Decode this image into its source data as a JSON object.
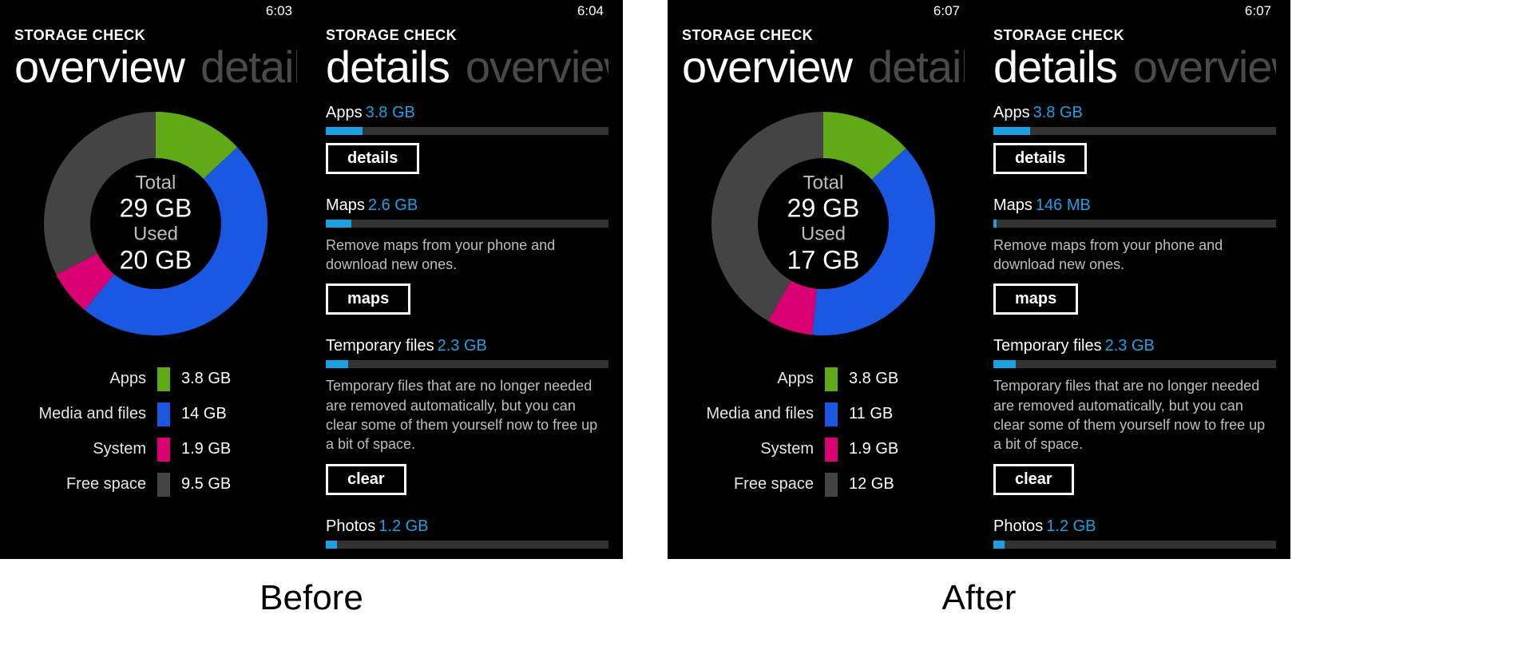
{
  "captions": {
    "before": "Before",
    "after": "After"
  },
  "before": {
    "overview": {
      "time": "6:03",
      "app_title": "STORAGE CHECK",
      "pivot_active": "overview",
      "pivot_inactive": "details",
      "center": {
        "total_label": "Total",
        "total_value": "29 GB",
        "used_label": "Used",
        "used_value": "20 GB"
      },
      "legend": [
        {
          "name": "Apps",
          "value": "3.8 GB",
          "color": "#60a917"
        },
        {
          "name": "Media and files",
          "value": "14 GB",
          "color": "#1b58e2"
        },
        {
          "name": "System",
          "value": "1.9 GB",
          "color": "#d80073"
        },
        {
          "name": "Free space",
          "value": "9.5 GB",
          "color": "#444444"
        }
      ]
    },
    "details": {
      "time": "6:04",
      "app_title": "STORAGE CHECK",
      "pivot_active": "details",
      "pivot_inactive": "overview",
      "items": [
        {
          "name": "Apps",
          "size": "3.8 GB",
          "pct": 13,
          "desc": "",
          "button": "details"
        },
        {
          "name": "Maps",
          "size": "2.6 GB",
          "pct": 9,
          "desc": "Remove maps from your phone and download new ones.",
          "button": "maps"
        },
        {
          "name": "Temporary files",
          "size": "2.3 GB",
          "pct": 8,
          "desc": "Temporary files that are no longer needed are removed automatically, but you can clear some of them yourself now to free up a bit of space.",
          "button": "clear"
        },
        {
          "name": "Photos",
          "size": "1.2 GB",
          "pct": 4,
          "desc": "",
          "button": ""
        }
      ]
    }
  },
  "after": {
    "overview": {
      "time": "6:07",
      "app_title": "STORAGE CHECK",
      "pivot_active": "overview",
      "pivot_inactive": "details",
      "center": {
        "total_label": "Total",
        "total_value": "29 GB",
        "used_label": "Used",
        "used_value": "17 GB"
      },
      "legend": [
        {
          "name": "Apps",
          "value": "3.8 GB",
          "color": "#60a917"
        },
        {
          "name": "Media and files",
          "value": "11 GB",
          "color": "#1b58e2"
        },
        {
          "name": "System",
          "value": "1.9 GB",
          "color": "#d80073"
        },
        {
          "name": "Free space",
          "value": "12 GB",
          "color": "#444444"
        }
      ]
    },
    "details": {
      "time": "6:07",
      "app_title": "STORAGE CHECK",
      "pivot_active": "details",
      "pivot_inactive": "overview",
      "items": [
        {
          "name": "Apps",
          "size": "3.8 GB",
          "pct": 13,
          "desc": "",
          "button": "details"
        },
        {
          "name": "Maps",
          "size": "146 MB",
          "pct": 1,
          "desc": "Remove maps from your phone and download new ones.",
          "button": "maps"
        },
        {
          "name": "Temporary files",
          "size": "2.3 GB",
          "pct": 8,
          "desc": "Temporary files that are no longer needed are removed automatically, but you can clear some of them yourself now to free up a bit of space.",
          "button": "clear"
        },
        {
          "name": "Photos",
          "size": "1.2 GB",
          "pct": 4,
          "desc": "",
          "button": ""
        }
      ]
    }
  },
  "chart_data": [
    {
      "type": "pie",
      "title": "Storage Check Overview (Before)",
      "total_gb": 29,
      "used_gb": 20,
      "series": [
        {
          "name": "Apps",
          "value_gb": 3.8,
          "color": "#60a917"
        },
        {
          "name": "Media and files",
          "value_gb": 14,
          "color": "#1b58e2"
        },
        {
          "name": "System",
          "value_gb": 1.9,
          "color": "#d80073"
        },
        {
          "name": "Free space",
          "value_gb": 9.5,
          "color": "#444444"
        }
      ]
    },
    {
      "type": "pie",
      "title": "Storage Check Overview (After)",
      "total_gb": 29,
      "used_gb": 17,
      "series": [
        {
          "name": "Apps",
          "value_gb": 3.8,
          "color": "#60a917"
        },
        {
          "name": "Media and files",
          "value_gb": 11,
          "color": "#1b58e2"
        },
        {
          "name": "System",
          "value_gb": 1.9,
          "color": "#d80073"
        },
        {
          "name": "Free space",
          "value_gb": 12,
          "color": "#444444"
        }
      ]
    }
  ]
}
